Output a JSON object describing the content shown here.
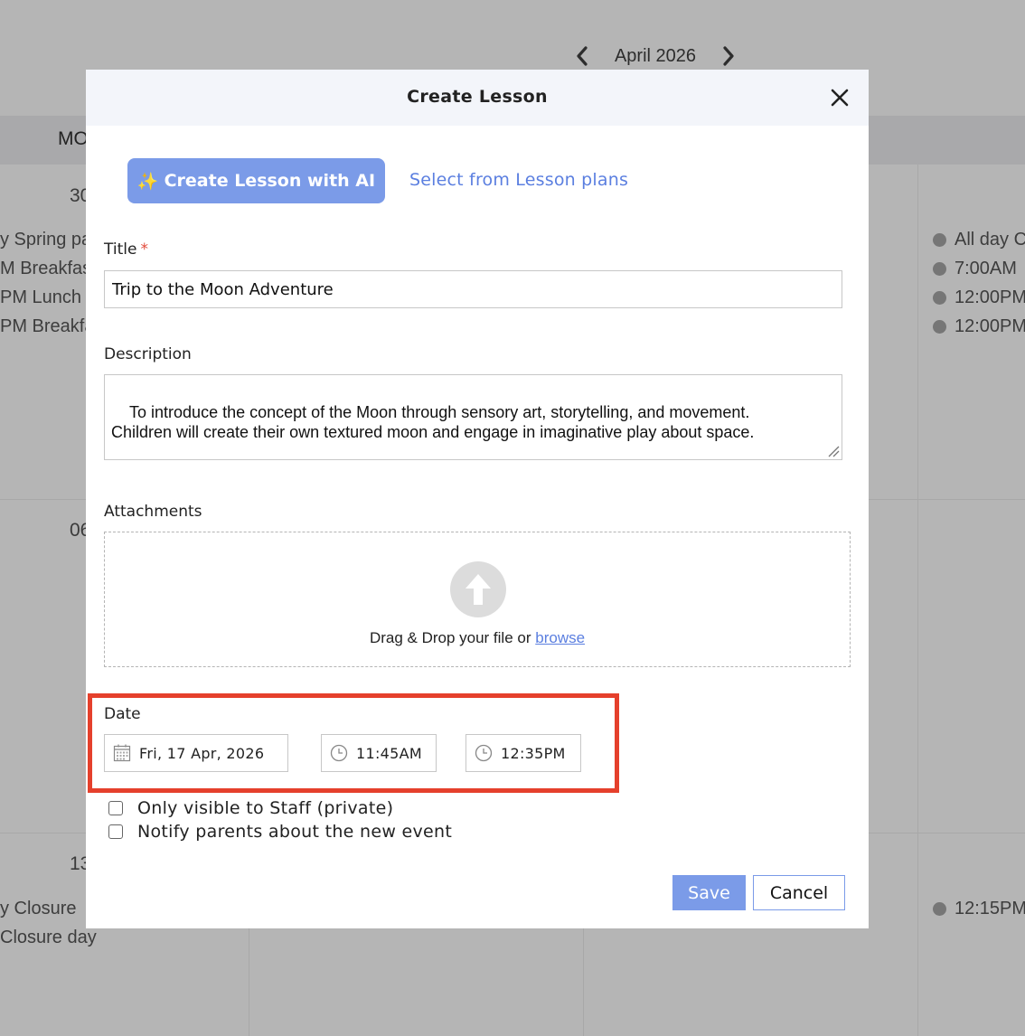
{
  "calendar": {
    "month_label": "April 2026",
    "weekday_label": "MO",
    "week_rows": [
      {
        "date": "30",
        "events_left": [
          "y Spring pa",
          "M Breakfas",
          "PM Lunch",
          "PM Breakfa"
        ],
        "events_right": [
          "All day C",
          "7:00AM",
          "12:00PM",
          "12:00PM"
        ]
      },
      {
        "date": "06"
      },
      {
        "date": "13",
        "events_left": [
          "y Closure",
          "Closure day"
        ],
        "events_right": [
          "12:15PM"
        ]
      }
    ]
  },
  "modal": {
    "title": "Create Lesson",
    "ai_button_icon": "✨",
    "ai_button": "Create Lesson with AI",
    "lesson_plans_link": "Select from Lesson plans",
    "title_label": "Title",
    "required_mark": "*",
    "title_value": "Trip to the Moon Adventure",
    "description_label": "Description",
    "description_value": "To introduce the concept of the Moon through sensory art, storytelling, and movement.\nChildren will create their own textured moon and engage in imaginative play about space.\n\nMaterial:",
    "attachments_label": "Attachments",
    "drop_text": "Drag & Drop your file or",
    "browse_link": "browse",
    "date_label": "Date",
    "date_value": "Fri, 17 Apr, 2026",
    "start_time": "11:45AM",
    "end_time": "12:35PM",
    "private_label": "Only visible to Staff (private)",
    "private_checked": false,
    "notify_label": "Notify parents about the new event",
    "notify_checked": false,
    "save_button": "Save",
    "cancel_button": "Cancel"
  },
  "colors": {
    "accent": "#7b9be8",
    "link": "#5b7fe0",
    "highlight": "#e5402c",
    "required": "#e24a3b"
  }
}
